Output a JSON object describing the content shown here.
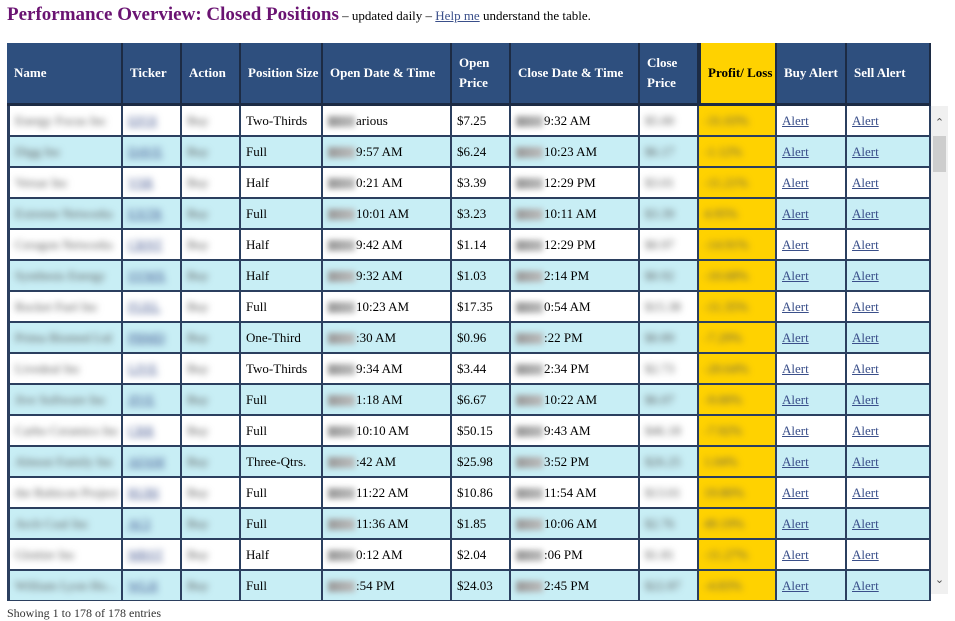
{
  "header": {
    "title": "Performance Overview: Closed Positions",
    "subtitle_pre": " – updated daily – ",
    "help_link": "Help me",
    "subtitle_post": " understand the table."
  },
  "table": {
    "columns": [
      "Name",
      "Ticker",
      "Action",
      "Position Size",
      "Open Date & Time",
      "Open Price",
      "Close Date & Time",
      "Close Price",
      "Profit/ Loss",
      "Buy Alert",
      "Sell Alert"
    ],
    "rows": [
      {
        "name": "Energy Focus Inc",
        "ticker": "EFOI",
        "action": "Buy",
        "size": "Two-Thirds",
        "open_dt": "arious",
        "open_price": "$7.25",
        "close_dt": "9:32 AM",
        "close_price": "$5.00",
        "pl": "-31.03%",
        "buy": "Alert",
        "sell": "Alert"
      },
      {
        "name": "Digg Inc",
        "ticker": "DAVE",
        "action": "Buy",
        "size": "Full",
        "open_dt": "9:57 AM",
        "open_price": "$6.24",
        "close_dt": "10:23 AM",
        "close_price": "$6.17",
        "pl": "-1.12%",
        "buy": "Alert",
        "sell": "Alert"
      },
      {
        "name": "Versar Inc",
        "ticker": "VSR",
        "action": "Buy",
        "size": "Half",
        "open_dt": "0:21 AM",
        "open_price": "$3.39",
        "close_dt": "12:29 PM",
        "close_price": "$3.01",
        "pl": "-11.21%",
        "buy": "Alert",
        "sell": "Alert"
      },
      {
        "name": "Extreme Networks",
        "ticker": "EXTR",
        "action": "Buy",
        "size": "Full",
        "open_dt": "10:01 AM",
        "open_price": "$3.23",
        "close_dt": "10:11 AM",
        "close_price": "$3.39",
        "pl": "4.95%",
        "buy": "Alert",
        "sell": "Alert"
      },
      {
        "name": "Ceragon Networks",
        "ticker": "CRNT",
        "action": "Buy",
        "size": "Half",
        "open_dt": "9:42 AM",
        "open_price": "$1.14",
        "close_dt": "12:29 PM",
        "close_price": "$0.97",
        "pl": "-14.91%",
        "buy": "Alert",
        "sell": "Alert"
      },
      {
        "name": "Synthesis Energy",
        "ticker": "SYMX",
        "action": "Buy",
        "size": "Half",
        "open_dt": "9:32 AM",
        "open_price": "$1.03",
        "close_dt": "2:14 PM",
        "close_price": "$0.92",
        "pl": "-10.68%",
        "buy": "Alert",
        "sell": "Alert"
      },
      {
        "name": "Rocket Fuel Inc",
        "ticker": "FUEL",
        "action": "Buy",
        "size": "Full",
        "open_dt": "10:23 AM",
        "open_price": "$17.35",
        "close_dt": "0:54 AM",
        "close_price": "$15.38",
        "pl": "-11.35%",
        "buy": "Alert",
        "sell": "Alert"
      },
      {
        "name": "Prima Biomed Ltd",
        "ticker": "PBMD",
        "action": "Buy",
        "size": "One-Third",
        "open_dt": ":30 AM",
        "open_price": "$0.96",
        "close_dt": ":22 PM",
        "close_price": "$0.89",
        "pl": "-7.29%",
        "buy": "Alert",
        "sell": "Alert"
      },
      {
        "name": "Livedeal Inc",
        "ticker": "LIVE",
        "action": "Buy",
        "size": "Two-Thirds",
        "open_dt": "9:34 AM",
        "open_price": "$3.44",
        "close_dt": "2:34 PM",
        "close_price": "$2.73",
        "pl": "-20.64%",
        "buy": "Alert",
        "sell": "Alert"
      },
      {
        "name": "Jive Software Inc",
        "ticker": "JIVE",
        "action": "Buy",
        "size": "Full",
        "open_dt": "1:18 AM",
        "open_price": "$6.67",
        "close_dt": "10:22 AM",
        "close_price": "$6.07",
        "pl": "-9.00%",
        "buy": "Alert",
        "sell": "Alert"
      },
      {
        "name": "Carbo Ceramics Inc",
        "ticker": "CRR",
        "action": "Buy",
        "size": "Full",
        "open_dt": "10:10 AM",
        "open_price": "$50.15",
        "close_dt": "9:43 AM",
        "close_price": "$46.18",
        "pl": "-7.92%",
        "buy": "Alert",
        "sell": "Alert"
      },
      {
        "name": "Almost Family Inc",
        "ticker": "AFAM",
        "action": "Buy",
        "size": "Three-Qtrs.",
        "open_dt": ":42 AM",
        "open_price": "$25.98",
        "close_dt": "3:52 PM",
        "close_price": "$26.25",
        "pl": "1.04%",
        "buy": "Alert",
        "sell": "Alert"
      },
      {
        "name": "the Rubicon Project",
        "ticker": "RUBI",
        "action": "Buy",
        "size": "Full",
        "open_dt": "11:22 AM",
        "open_price": "$10.86",
        "close_dt": "11:54 AM",
        "close_price": "$13.01",
        "pl": "19.80%",
        "buy": "Alert",
        "sell": "Alert"
      },
      {
        "name": "Arch Coal Inc",
        "ticker": "ACI",
        "action": "Buy",
        "size": "Full",
        "open_dt": "11:36 AM",
        "open_price": "$1.85",
        "close_dt": "10:06 AM",
        "close_price": "$2.76",
        "pl": "49.19%",
        "buy": "Alert",
        "sell": "Alert"
      },
      {
        "name": "Glottier Inc",
        "ticker": "MRST",
        "action": "Buy",
        "size": "Half",
        "open_dt": "0:12 AM",
        "open_price": "$2.04",
        "close_dt": ":06 PM",
        "close_price": "$1.81",
        "pl": "-11.27%",
        "buy": "Alert",
        "sell": "Alert"
      },
      {
        "name": "William Lyon Ho...",
        "ticker": "WLH",
        "action": "Buy",
        "size": "Full",
        "open_dt": ":54 PM",
        "open_price": "$24.03",
        "close_dt": "2:45 PM",
        "close_price": "$22.87",
        "pl": "-4.83%",
        "buy": "Alert",
        "sell": "Alert"
      }
    ]
  },
  "scrollbar": {
    "up_icon": "⌃",
    "down_icon": "⌄"
  },
  "footer": {
    "entries": "Showing 1 to 178 of 178 entries"
  },
  "colors": {
    "header_bg": "#2e4f7e",
    "profit_loss": "#ffd200",
    "row_alt": "#c8eef5",
    "title": "#6a1372"
  }
}
